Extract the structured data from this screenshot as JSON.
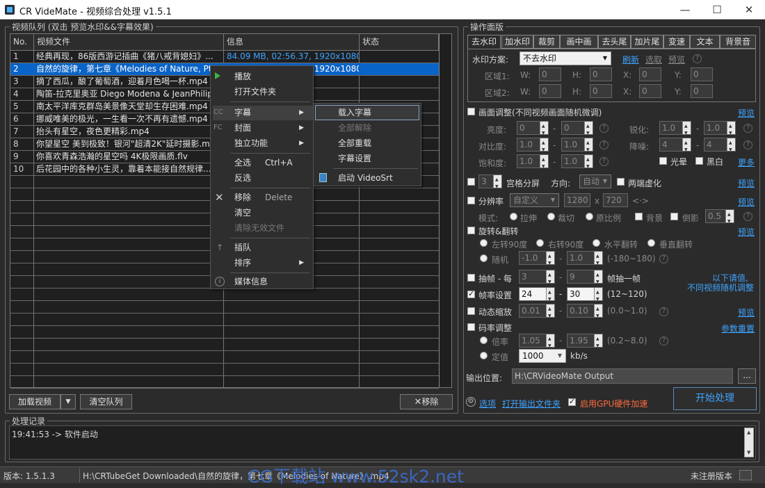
{
  "window": {
    "title": "CR VideMate - 视频综合处理 v1.5.1",
    "minimize": "—",
    "maximize": "☐",
    "close": "✕"
  },
  "queue": {
    "group_label": "视频队列 (双击 预览水印&&字幕效果)",
    "columns": [
      "No.",
      "视频文件",
      "信息",
      "状态"
    ],
    "rows": [
      {
        "no": "1",
        "file": "经典再现，86版西游记插曲《猪八戒背媳妇》...",
        "info": "84.09 MB, 02:56.37, 1920x1080"
      },
      {
        "no": "2",
        "file": "自然的旋律，第七章《Melodies of Nature, Pt...",
        "info": "76.36 MB, 05:52.04, 1920x1080"
      },
      {
        "no": "3",
        "file": "摘了西瓜，酿了葡萄酒，迎着月色喝一杯.mp4",
        "info": "1280x720"
      },
      {
        "no": "4",
        "file": "陶笛-拉克里奥亚 Diego Modena & JeanPhilippe...",
        "info": "1280x720"
      },
      {
        "no": "5",
        "file": "南太平洋库克群岛美景像天堂却生存困难.mp4",
        "info": ""
      },
      {
        "no": "6",
        "file": "挪威唯美的极光，一生看一次不再有遗憾.mp4",
        "info": ""
      },
      {
        "no": "7",
        "file": "抬头有星空，夜色更精彩.mp4",
        "info": ""
      },
      {
        "no": "8",
        "file": "你望星空 美到极致！银河\"超清2K\"延时摄影.mp4",
        "info": ""
      },
      {
        "no": "9",
        "file": "你喜欢青森浩瀚的星空吗 4K极限画质.flv",
        "info": ""
      },
      {
        "no": "10",
        "file": "后花园中的各种小生灵，靠着本能接自然规律...",
        "info": ""
      }
    ],
    "add_button": "加载视频",
    "clear_button": "清空队列",
    "remove_button": "移除"
  },
  "context_menu": {
    "items": [
      {
        "label": "播放"
      },
      {
        "label": "打开文件夹"
      },
      {
        "label": "字幕"
      },
      {
        "label": "封面"
      },
      {
        "label": "独立功能"
      },
      {
        "label": "全选",
        "shortcut": "Ctrl+A"
      },
      {
        "label": "反选"
      },
      {
        "label": "移除",
        "shortcut": "Delete"
      },
      {
        "label": "清空"
      },
      {
        "label": "清除无效文件"
      },
      {
        "label": "插队"
      },
      {
        "label": "排序"
      },
      {
        "label": "媒体信息"
      }
    ],
    "submenu": [
      {
        "label": "载入字幕"
      },
      {
        "label": "全部解除"
      },
      {
        "label": "全部重载"
      },
      {
        "label": "字幕设置"
      },
      {
        "label": "启动 VideoSrt"
      }
    ]
  },
  "ops": {
    "group_label": "操作面版",
    "tabs": [
      "去水印",
      "加水印",
      "裁剪",
      "画中画",
      "去头尾",
      "加片尾",
      "变速",
      "文本",
      "背景音"
    ],
    "watermark": {
      "scheme_label": "水印方案:",
      "scheme_value": "不去水印",
      "refresh": "刷新",
      "pick": "选取",
      "preview": "预览",
      "area1": "区域1:",
      "area2": "区域2:",
      "w": "W:",
      "h": "H:",
      "x": "X:",
      "y": "Y:",
      "zero": "0"
    },
    "picture": {
      "label": "画面调整(不同视频画面随机微调)",
      "preview": "预览",
      "brightness": "亮度:",
      "sharpen": "锐化:",
      "contrast": "对比度:",
      "denoise": "降噪:",
      "saturation": "饱和度:",
      "glow": "光晕",
      "bw": "黑白",
      "more": "更多",
      "v0": "0",
      "v1": "1.0",
      "v4": "4"
    },
    "grid": {
      "count": "3",
      "label": "宫格分屏",
      "dir_label": "方向:",
      "dir_value": "自动",
      "blur": "两端虚化",
      "preview": "预览"
    },
    "resolution": {
      "label": "分辨率",
      "value": "自定义",
      "w": "1280",
      "x": "x",
      "h": "720",
      "link": "<·>",
      "mode": "模式:",
      "stretch": "拉伸",
      "crop": "裁切",
      "ratio": "原比例",
      "bg": "背景",
      "reflect": "倒影",
      "reflect_val": "0.5",
      "preview": "预览"
    },
    "rotate": {
      "label": "旋转&翻转",
      "preview": "预览",
      "r90": "左转90度",
      "rr90": "右转90度",
      "hflip": "水平翻转",
      "vflip": "垂直翻转",
      "random": "随机",
      "a": "-1.0",
      "b": "1.0",
      "range": "(-180~180)"
    },
    "frames": {
      "label": "抽帧 - 每",
      "a": "3",
      "b": "9",
      "unit": "帧抽一帧",
      "note1": "以下请值,",
      "note2": "不同视频随机调整"
    },
    "fps": {
      "label": "帧率设置",
      "a": "24",
      "b": "30",
      "range": "(12~120)"
    },
    "zoom": {
      "label": "动态缩放",
      "a": "0.01",
      "b": "0.10",
      "range": "(0.0~1.0)",
      "preview": "预览"
    },
    "bitrate": {
      "label": "码率调整",
      "reset": "参数重置",
      "mult": "倍率",
      "a": "1.05",
      "b": "1.95",
      "range": "(0.2~8.0)",
      "fixed": "定值",
      "fixed_val": "1000",
      "unit": "kb/s"
    },
    "output": {
      "label": "输出位置:",
      "path": "H:\\CRVideoMate Output",
      "browse": "..."
    },
    "options": "选项",
    "open_output": "打开输出文件夹",
    "gpu": "启用GPU硬件加速",
    "start": "开始处理"
  },
  "log": {
    "group_label": "处理记录",
    "entry": "19:41:53 -> 软件启动"
  },
  "status": {
    "version": "版本: 1.5.1.3",
    "path": "H:\\CRTubeGet Downloaded\\自然的旋律，第七章《Melodies of Nature》.mp4",
    "watermark": "CG下载站 www.52sk2.net",
    "reg": "未注册版本"
  },
  "colors": {
    "accent": "#0a63c6",
    "link": "#3ea3ff",
    "warn": "#ff6a3d"
  }
}
